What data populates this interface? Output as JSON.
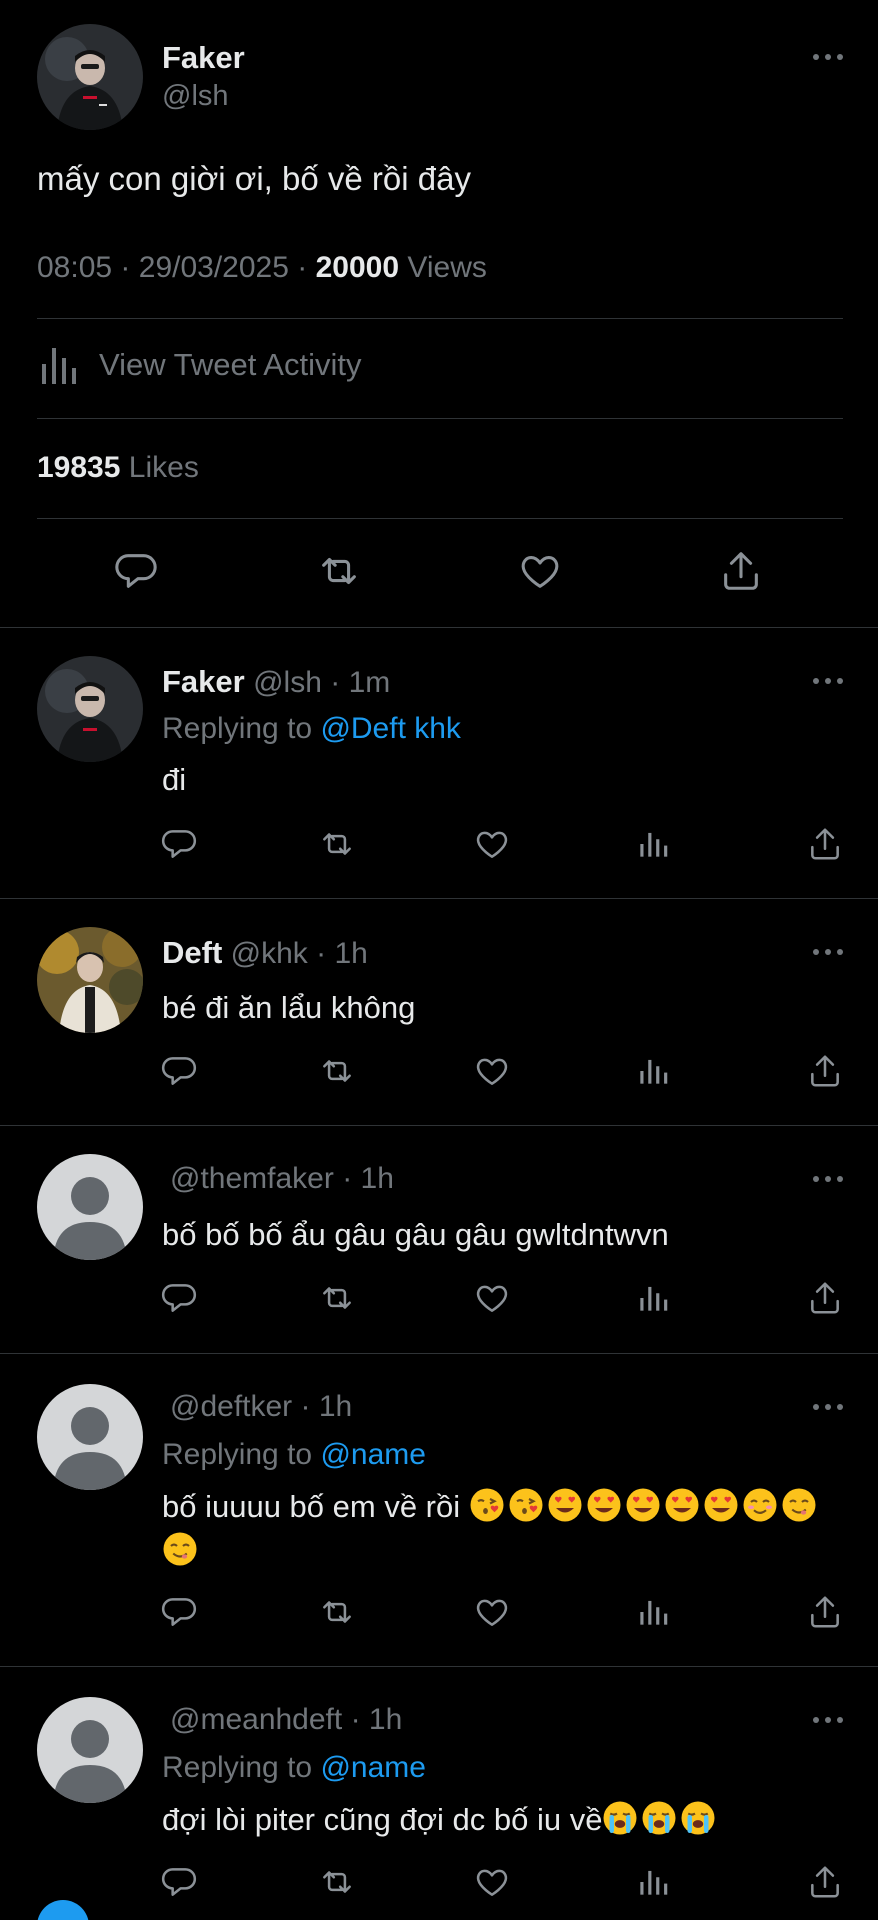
{
  "main_tweet": {
    "author_name": "Faker",
    "author_handle": "@lsh",
    "text": "mấy con giời ơi, bố về rồi đây",
    "time": "08:05",
    "date": "29/03/2025",
    "views_count": "20000",
    "views_label": "Views",
    "activity_label": "View Tweet Activity",
    "likes_count": "19835",
    "likes_label": "Likes"
  },
  "replies": [
    {
      "name": "Faker",
      "handle": "@lsh",
      "time": "1m",
      "replying_label": "Replying to",
      "replying_to": "@Deft khk",
      "text": "đi",
      "avatar": "faker-photo"
    },
    {
      "name": "Deft",
      "handle": "@khk",
      "time": "1h",
      "text": "bé đi ăn lẩu không",
      "avatar": "deft-photo"
    },
    {
      "name": "",
      "handle": "@themfaker",
      "time": "1h",
      "text": "bố bố bố ẩu gâu gâu gâu gwltdntwvn",
      "avatar": "default-avatar"
    },
    {
      "name": "",
      "handle": "@deftker",
      "time": "1h",
      "replying_label": "Replying to",
      "replying_to": "@name",
      "text": "bố iuuuu bố em về rồi",
      "emojis": [
        "kissing-heart",
        "kissing-heart",
        "heart-eyes",
        "heart-eyes",
        "heart-eyes",
        "heart-eyes",
        "heart-eyes",
        "smiling-blush",
        "yum",
        "yum"
      ],
      "avatar": "default-avatar"
    },
    {
      "name": "",
      "handle": "@meanhdeft",
      "time": "1h",
      "replying_label": "Replying to",
      "replying_to": "@name",
      "text": "đợi lòi piter cũng đợi dc bố iu về",
      "emojis": [
        "loudly-crying",
        "loudly-crying",
        "loudly-crying"
      ],
      "avatar": "default-avatar"
    }
  ],
  "separator": "·",
  "colors": {
    "background": "#000000",
    "text": "#e7e9ea",
    "muted": "#71767b",
    "link": "#1d9bf0",
    "divider": "#2f3336"
  }
}
